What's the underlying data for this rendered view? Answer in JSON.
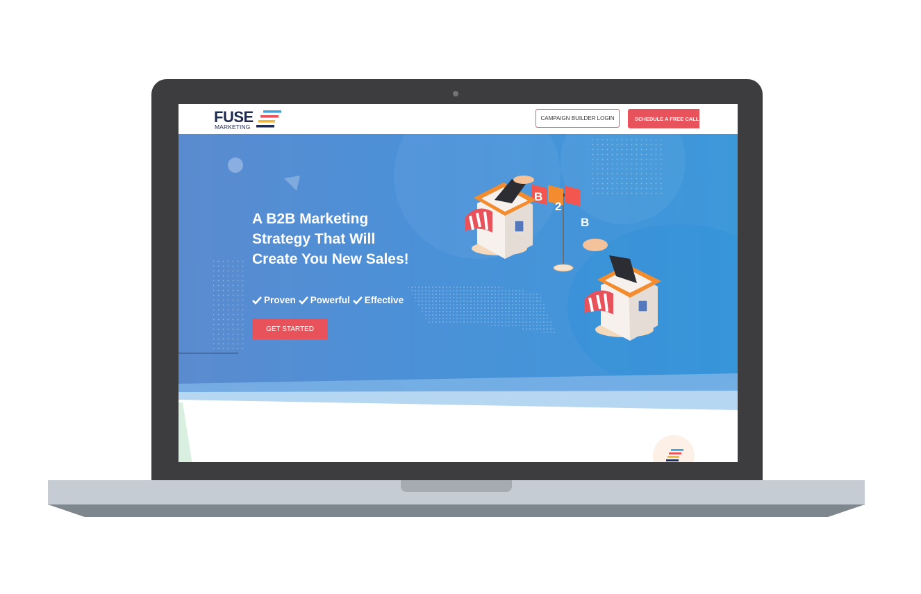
{
  "brand": {
    "name": "FUSE",
    "subtitle": "MARKETING",
    "bar_colors": [
      "#3aa6df",
      "#e8525a",
      "#f2b531",
      "#1e2b4e"
    ]
  },
  "nav": {
    "login_label": "CAMPAIGN BUILDER LOGIN",
    "cta_label": "SCHEDULE A FREE CALL"
  },
  "hero": {
    "headline": "A B2B Marketing Strategy That Will Create You New Sales!",
    "features": [
      "Proven",
      "Powerful",
      "Effective"
    ],
    "cta_label": "GET STARTED",
    "illustration_flags": [
      "B",
      "2",
      "B"
    ]
  },
  "colors": {
    "accent": "#e8525a",
    "hero_blue": "#4a91d8",
    "navy": "#1e2b4e",
    "flag_orange": "#f28c2e"
  }
}
